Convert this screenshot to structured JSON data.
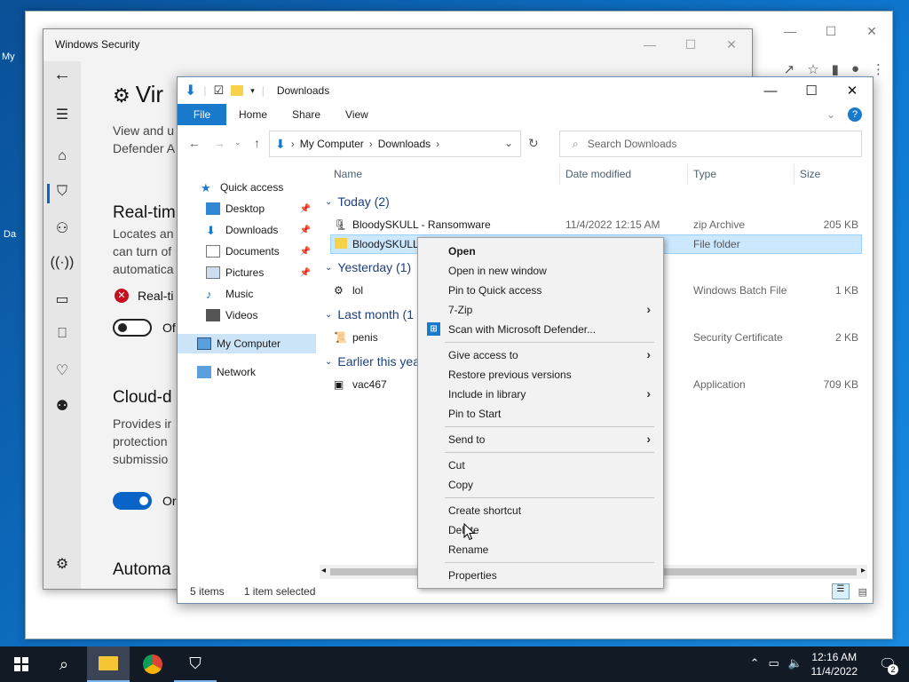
{
  "desktop": {
    "icon1": "My",
    "icon2": "Da"
  },
  "security": {
    "title": "Windows Security",
    "heading": "Vir",
    "intro_line1": "View and u",
    "intro_line2": "Defender A",
    "realtime_title": "Real-tim",
    "realtime_desc1": "Locates an",
    "realtime_desc2": "can turn of",
    "realtime_desc3": "automatica",
    "realtime_warning": "Real-ti",
    "realtime_toggle": "Of",
    "cloud_title": "Cloud-d",
    "cloud_desc1": "Provides ir",
    "cloud_desc2": "protection",
    "cloud_desc3": "submissio",
    "cloud_toggle": "Or",
    "auto_title": "Automa"
  },
  "explorer": {
    "title": "Downloads",
    "tabs": [
      "File",
      "Home",
      "Share",
      "View"
    ],
    "breadcrumb": [
      "My Computer",
      "Downloads"
    ],
    "search_placeholder": "Search Downloads",
    "nav": [
      {
        "label": "Quick access"
      },
      {
        "label": "Desktop"
      },
      {
        "label": "Downloads"
      },
      {
        "label": "Documents"
      },
      {
        "label": "Pictures"
      },
      {
        "label": "Music"
      },
      {
        "label": "Videos"
      },
      {
        "label": "My Computer"
      },
      {
        "label": "Network"
      }
    ],
    "columns": [
      "Name",
      "Date modified",
      "Type",
      "Size"
    ],
    "groups": [
      "Today (2)",
      "Yesterday (1)",
      "Last month (1",
      "Earlier this yea"
    ],
    "rows": [
      {
        "name": "BloodySKULL - Ransomware",
        "date": "11/4/2022 12:15 AM",
        "type": "zip Archive",
        "size": "205 KB"
      },
      {
        "name": "BloodySKULL",
        "date": "",
        "type": "File folder",
        "size": ""
      },
      {
        "name": "lol",
        "date": "",
        "type": "Windows Batch File",
        "size": "1 KB"
      },
      {
        "name": "penis",
        "date": "",
        "type": "Security Certificate",
        "size": "2 KB"
      },
      {
        "name": "vac467",
        "date": "",
        "type": "Application",
        "size": "709 KB"
      }
    ],
    "status_items": "5 items",
    "status_selected": "1 item selected"
  },
  "context_menu": [
    "Open",
    "Open in new window",
    "Pin to Quick access",
    "7-Zip",
    "Scan with Microsoft Defender...",
    "Give access to",
    "Restore previous versions",
    "Include in library",
    "Pin to Start",
    "Send to",
    "Cut",
    "Copy",
    "Create shortcut",
    "Delete",
    "Rename",
    "Properties"
  ],
  "taskbar": {
    "time": "12:16 AM",
    "date": "11/4/2022",
    "notifications": "2"
  }
}
